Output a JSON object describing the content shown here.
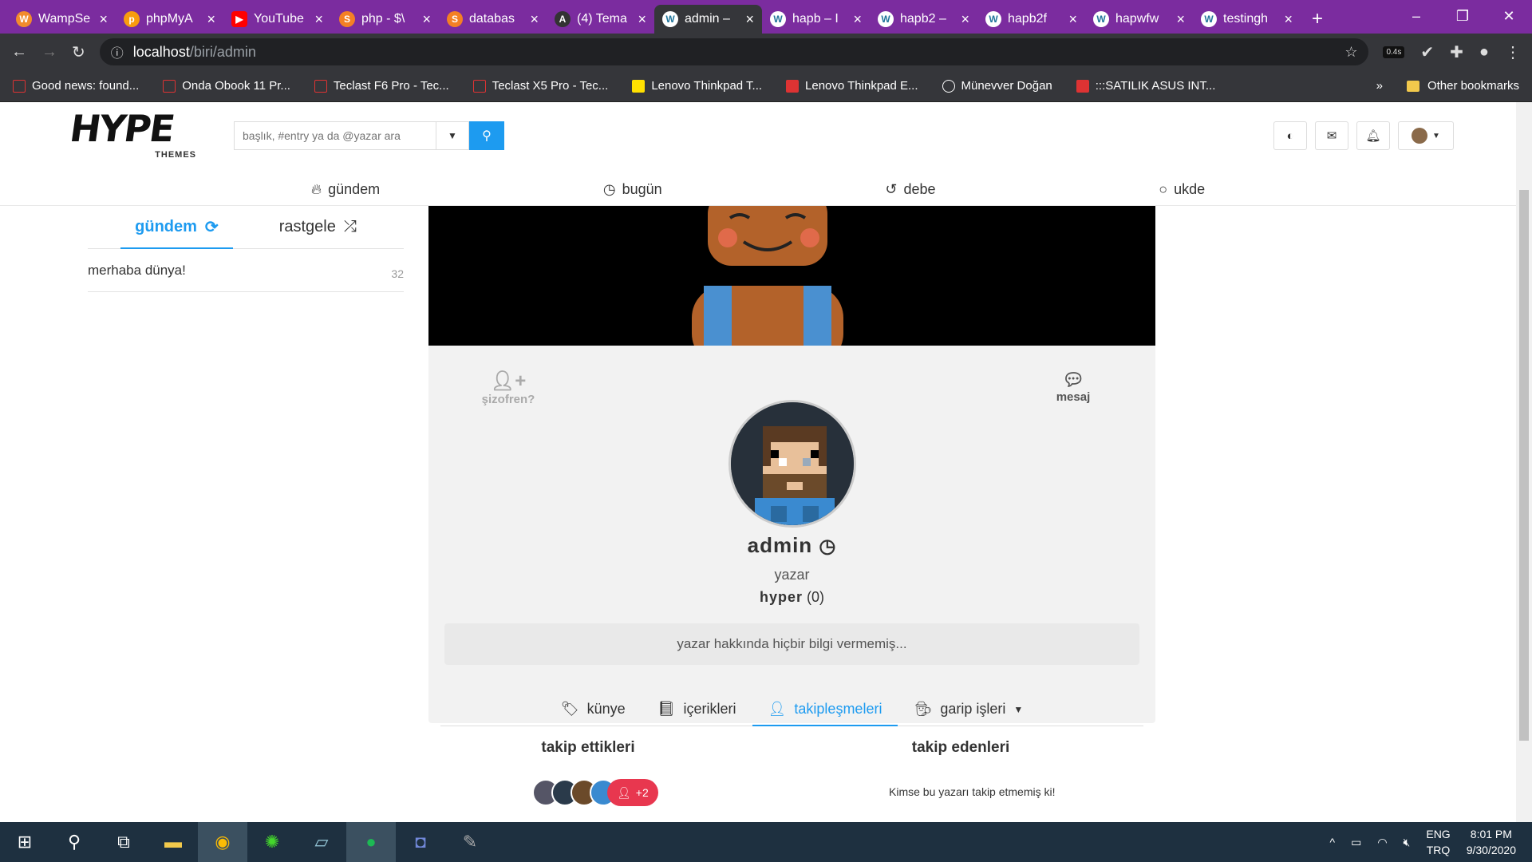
{
  "browser": {
    "tabs": [
      {
        "title": "WampSe",
        "icon_color": "#f28b2d"
      },
      {
        "title": "phpMyA",
        "icon_color": "#f89c0e"
      },
      {
        "title": "YouTube",
        "icon_color": "#ff0000"
      },
      {
        "title": "php - $\\",
        "icon_color": "#f48024"
      },
      {
        "title": "databas",
        "icon_color": "#f48024"
      },
      {
        "title": "(4) Tema",
        "icon_color": "#333333"
      },
      {
        "title": "admin –",
        "icon_color": "#21759b",
        "active": true
      },
      {
        "title": "hapb – I",
        "icon_color": "#21759b"
      },
      {
        "title": "hapb2 –",
        "icon_color": "#21759b"
      },
      {
        "title": "hapb2f",
        "icon_color": "#21759b"
      },
      {
        "title": "hapwfw",
        "icon_color": "#21759b"
      },
      {
        "title": "testingh",
        "icon_color": "#21759b"
      }
    ],
    "url_host": "localhost",
    "url_path": "/biri/admin",
    "ext_badge": "0.4s",
    "bookmarks": [
      "Good news: found...",
      "Onda Obook 11 Pr...",
      "Teclast F6 Pro - Tec...",
      "Teclast X5 Pro - Tec...",
      "Lenovo Thinkpad T...",
      "Lenovo Thinkpad E...",
      "Münevver Doğan",
      ":::SATILIK ASUS INT..."
    ],
    "other_bookmarks": "Other bookmarks",
    "more": "»"
  },
  "header": {
    "logo_big": "HYPE",
    "logo_small": "THEMES",
    "search_placeholder": "başlık, #entry ya da @yazar ara"
  },
  "nav": {
    "items": [
      {
        "label": "gündem",
        "icon": "fire-icon"
      },
      {
        "label": "bugün",
        "icon": "clock-icon"
      },
      {
        "label": "debe",
        "icon": "history-icon"
      },
      {
        "label": "ukde",
        "icon": "circle-icon"
      }
    ]
  },
  "sidebar": {
    "tabs": [
      {
        "label": "gündem",
        "icon": "refresh-icon"
      },
      {
        "label": "rastgele",
        "icon": "shuffle-icon"
      }
    ],
    "topics": [
      {
        "title": "merhaba dünya!",
        "count": "32"
      }
    ]
  },
  "profile": {
    "action_left": "şizofren?",
    "action_right": "mesaj",
    "username": "admin",
    "role": "yazar",
    "badge_name": "hyper",
    "badge_count": "(0)",
    "about": "yazar hakkında hiçbir bilgi vermemiş...",
    "tabs": [
      {
        "label": "künye",
        "icon": "tag-icon"
      },
      {
        "label": "içerikleri",
        "icon": "book-icon"
      },
      {
        "label": "takipleşmeleri",
        "icon": "user-icon",
        "active": true
      },
      {
        "label": "garip işleri",
        "icon": "user-secret-icon"
      }
    ],
    "following_title": "takip ettikleri",
    "followers_title": "takip edenleri",
    "following_more": "+2",
    "no_followers": "Kimse bu yazarı takip etmemiş ki!"
  },
  "taskbar": {
    "lang_top": "ENG",
    "lang_bottom": "TRQ",
    "time": "8:01 PM",
    "date": "9/30/2020"
  },
  "colors": {
    "accent": "#1d9bf0",
    "tabbar": "#7b2c9f",
    "follow_badge": "#e8374f"
  }
}
